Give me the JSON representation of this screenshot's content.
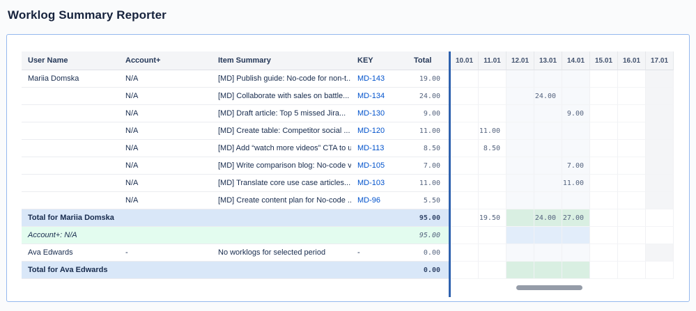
{
  "page": {
    "title": "Worklog Summary Reporter"
  },
  "colors": {
    "link": "#0052cc",
    "divider": "#2f62ae",
    "header-bg": "#f4f5f7",
    "group-bg": "#d9e7f8",
    "account-bg": "#e3fcef",
    "band-item": "#f7f9fc",
    "band-group": "#d9efe2",
    "band-account": "#e2edfa",
    "last-col": "#f4f5f7",
    "num": "#54637e",
    "text": "#172b4d",
    "row-border": "#ebecf0",
    "card-border": "#94b8ee",
    "scroll-thumb": "#959ca8"
  },
  "table": {
    "headers": {
      "user": "User Name",
      "account": "Account+",
      "summary": "Item Summary",
      "key": "KEY",
      "total": "Total"
    },
    "date_headers": [
      "10.01",
      "11.01",
      "12.01",
      "13.01",
      "14.01",
      "15.01",
      "16.01",
      "17.01"
    ],
    "band_columns": [
      2,
      3,
      4
    ],
    "rows": [
      {
        "type": "item",
        "user": "Mariia Domska",
        "account": "N/A",
        "summary": "[MD] Publish guide: No-code for non-t...",
        "key": "MD-143",
        "key_is_link": true,
        "total": "19.00",
        "cells": [
          "",
          "",
          "",
          "",
          "",
          "",
          "",
          ""
        ]
      },
      {
        "type": "item",
        "user": "",
        "account": "N/A",
        "summary": "[MD] Collaborate with sales on battle...",
        "key": "MD-134",
        "key_is_link": true,
        "total": "24.00",
        "cells": [
          "",
          "",
          "",
          "24.00",
          "",
          "",
          "",
          ""
        ]
      },
      {
        "type": "item",
        "user": "",
        "account": "N/A",
        "summary": "[MD] Draft article: Top 5 missed Jira...",
        "key": "MD-130",
        "key_is_link": true,
        "total": "9.00",
        "cells": [
          "",
          "",
          "",
          "",
          "9.00",
          "",
          "",
          ""
        ]
      },
      {
        "type": "item",
        "user": "",
        "account": "N/A",
        "summary": "[MD] Create table: Competitor social ...",
        "key": "MD-120",
        "key_is_link": true,
        "total": "11.00",
        "cells": [
          "",
          "11.00",
          "",
          "",
          "",
          "",
          "",
          ""
        ]
      },
      {
        "type": "item",
        "user": "",
        "account": "N/A",
        "summary": "[MD] Add “watch more videos” CTA to u...",
        "key": "MD-113",
        "key_is_link": true,
        "total": "8.50",
        "cells": [
          "",
          "8.50",
          "",
          "",
          "",
          "",
          "",
          ""
        ]
      },
      {
        "type": "item",
        "user": "",
        "account": "N/A",
        "summary": "[MD] Write comparison blog: No-code v...",
        "key": "MD-105",
        "key_is_link": true,
        "total": "7.00",
        "cells": [
          "",
          "",
          "",
          "",
          "7.00",
          "",
          "",
          ""
        ]
      },
      {
        "type": "item",
        "user": "",
        "account": "N/A",
        "summary": "[MD] Translate core use case articles...",
        "key": "MD-103",
        "key_is_link": true,
        "total": "11.00",
        "cells": [
          "",
          "",
          "",
          "",
          "11.00",
          "",
          "",
          ""
        ]
      },
      {
        "type": "item",
        "user": "",
        "account": "N/A",
        "summary": "[MD] Create content plan for No-code ...",
        "key": "MD-96",
        "key_is_link": true,
        "total": "5.50",
        "cells": [
          "",
          "",
          "",
          "",
          "",
          "",
          "",
          ""
        ]
      },
      {
        "type": "group-total",
        "label": "Total for Mariia Domska",
        "total": "95.00",
        "cells": [
          "",
          "19.50",
          "",
          "24.00",
          "27.00",
          "",
          "",
          ""
        ]
      },
      {
        "type": "account-total",
        "label": "Account+: N/A",
        "total": "95.00",
        "cells": [
          "",
          "",
          "",
          "",
          "",
          "",
          "",
          ""
        ]
      },
      {
        "type": "item",
        "user": "Ava Edwards",
        "account": "-",
        "summary": "No worklogs for selected period",
        "key": "-",
        "key_is_link": false,
        "total": "0.00",
        "cells": [
          "",
          "",
          "",
          "",
          "",
          "",
          "",
          ""
        ]
      },
      {
        "type": "group-total",
        "label": "Total for Ava Edwards",
        "total": "0.00",
        "cells": [
          "",
          "",
          "",
          "",
          "",
          "",
          "",
          ""
        ]
      }
    ]
  }
}
